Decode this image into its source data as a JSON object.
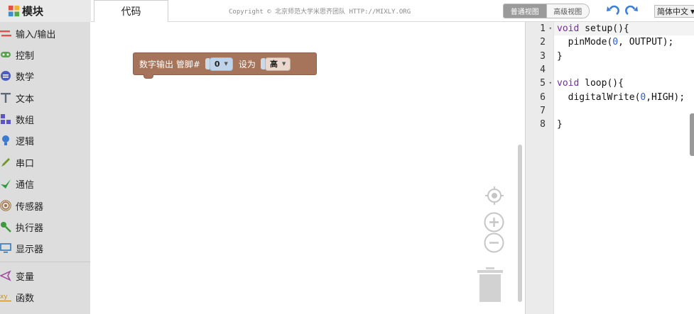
{
  "brand": {
    "title": "模块"
  },
  "tabs": {
    "code": "代码"
  },
  "header": {
    "copyright": "Copyright © 北京师范大学米思齐团队 HTTP://MIXLY.ORG",
    "view_normal": "普通视图",
    "view_advanced": "高级视图",
    "language": "简体中文"
  },
  "sidebar": {
    "items": [
      {
        "label": "输入/输出",
        "icon": "io-arrows-icon",
        "color": "#d9534f"
      },
      {
        "label": "控制",
        "icon": "gamepad-icon",
        "color": "#5aa150"
      },
      {
        "label": "数学",
        "icon": "math-circle-icon",
        "color": "#4f5bbd"
      },
      {
        "label": "文本",
        "icon": "text-t-icon",
        "color": "#5c6b7a"
      },
      {
        "label": "数组",
        "icon": "array-blocks-icon",
        "color": "#5a56c6"
      },
      {
        "label": "逻辑",
        "icon": "bulb-icon",
        "color": "#3a7ad0"
      },
      {
        "label": "串口",
        "icon": "pen-icon",
        "color": "#6f9a2a"
      },
      {
        "label": "通信",
        "icon": "arrow-icon",
        "color": "#2e9a3a"
      },
      {
        "label": "传感器",
        "icon": "sensor-icon",
        "color": "#a0713e"
      },
      {
        "label": "执行器",
        "icon": "actuator-icon",
        "color": "#3b9a3b"
      },
      {
        "label": "显示器",
        "icon": "monitor-icon",
        "color": "#2f7bbf"
      },
      {
        "label": "变量",
        "icon": "variable-icon",
        "color": "#a24fa1"
      },
      {
        "label": "函数",
        "icon": "function-xy-icon",
        "color": "#c98a2a"
      }
    ]
  },
  "block": {
    "label": "数字输出 管脚#",
    "pin": "0",
    "set_label": "设为",
    "level": "高"
  },
  "editor": {
    "lines": [
      {
        "n": "1",
        "fold": true,
        "parts": [
          {
            "t": "void",
            "c": "kw"
          },
          {
            "t": " setup(){",
            "c": ""
          }
        ]
      },
      {
        "n": "2",
        "fold": false,
        "parts": [
          {
            "t": "  pinMode(",
            "c": ""
          },
          {
            "t": "0",
            "c": "num"
          },
          {
            "t": ", OUTPUT);",
            "c": ""
          }
        ]
      },
      {
        "n": "3",
        "fold": false,
        "parts": [
          {
            "t": "}",
            "c": ""
          }
        ]
      },
      {
        "n": "4",
        "fold": false,
        "parts": []
      },
      {
        "n": "5",
        "fold": true,
        "parts": [
          {
            "t": "void",
            "c": "kw"
          },
          {
            "t": " loop(){",
            "c": ""
          }
        ]
      },
      {
        "n": "6",
        "fold": false,
        "parts": [
          {
            "t": "  digitalWrite(",
            "c": ""
          },
          {
            "t": "0",
            "c": "num"
          },
          {
            "t": ",HIGH);",
            "c": ""
          }
        ]
      },
      {
        "n": "7",
        "fold": false,
        "parts": []
      },
      {
        "n": "8",
        "fold": false,
        "parts": [
          {
            "t": "}",
            "c": ""
          }
        ]
      }
    ]
  }
}
